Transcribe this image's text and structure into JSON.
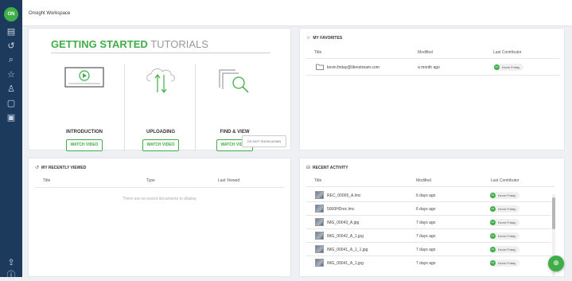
{
  "app": {
    "logo_text": "ON",
    "workspace_title": "Onsight Workspace"
  },
  "sidebar": {
    "icons": [
      "files-icon",
      "history-icon",
      "search-icon",
      "star-icon",
      "user-icon",
      "clipboard-icon",
      "clipboard-list-icon",
      "upload-icon",
      "info-icon"
    ]
  },
  "tutorials": {
    "heading_strong": "GETTING STARTED",
    "heading_light": "TUTORIALS",
    "items": [
      {
        "label": "INTRODUCTION",
        "button": "WATCH VIDEO"
      },
      {
        "label": "UPLOADING",
        "button": "WATCH VIDEO"
      },
      {
        "label": "FIND & VIEW",
        "button": "WATCH VIDEO"
      }
    ],
    "dont_show": "DO NOT SHOW AGAIN"
  },
  "favorites": {
    "title": "MY FAVORITES",
    "columns": [
      "Title",
      "Modified",
      "Last Contributor"
    ],
    "rows": [
      {
        "title": "kevin.friday@librestream.com",
        "modified": "a month ago",
        "contributor": "Kevin Friday",
        "initials": "KF"
      }
    ]
  },
  "recently_viewed": {
    "title": "MY RECENTLY VIEWED",
    "columns": [
      "Title",
      "Type",
      "Last Viewed"
    ],
    "empty": "There are no recent documents to display."
  },
  "recent_activity": {
    "title": "RECENT ACTIVITY",
    "columns": [
      "Title",
      "Modified",
      "Last Contributor"
    ],
    "rows": [
      {
        "title": "REC_00005_A.lmc",
        "modified": "6 days ago",
        "contributor": "Kevin Friday",
        "initials": "KF"
      },
      {
        "title": "5000HDrec.lmc",
        "modified": "6 days ago",
        "contributor": "Kevin Friday",
        "initials": "KF"
      },
      {
        "title": "IMG_00043_A.jpg",
        "modified": "7 days ago",
        "contributor": "Kevin Friday",
        "initials": "KF"
      },
      {
        "title": "IMG_00042_A_1.jpg",
        "modified": "7 days ago",
        "contributor": "Kevin Friday",
        "initials": "KF"
      },
      {
        "title": "IMG_00041_A_1_1.jpg",
        "modified": "7 days ago",
        "contributor": "Kevin Friday",
        "initials": "KF"
      },
      {
        "title": "IMG_00041_A_1.jpg",
        "modified": "7 days ago",
        "contributor": "Kevin Friday",
        "initials": "KF"
      }
    ]
  },
  "colors": {
    "brand_green": "#3fae49",
    "sidebar_navy": "#1b3a5c"
  }
}
